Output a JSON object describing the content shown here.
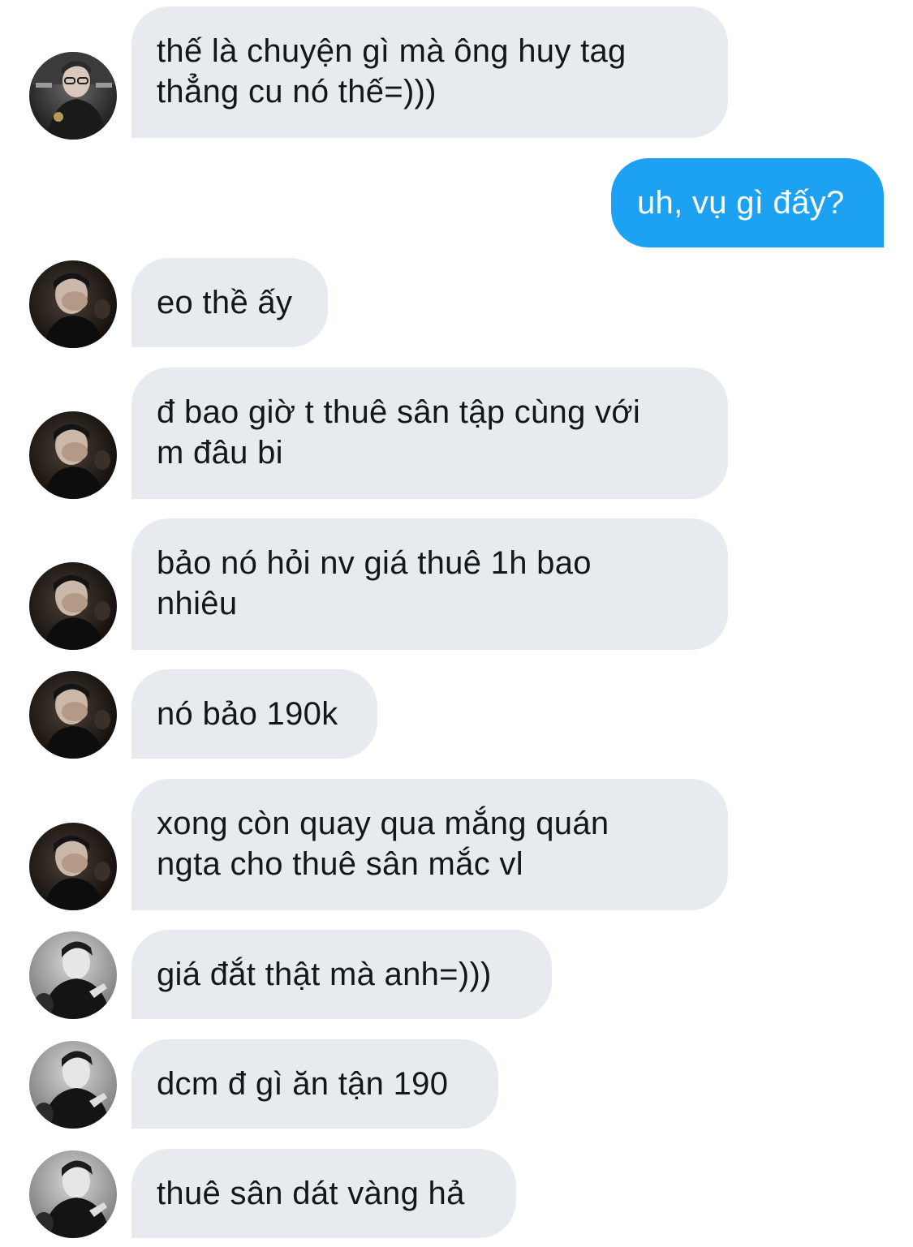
{
  "conversation": {
    "messages": [
      {
        "sender": "user-a",
        "text": "thế là chuyện gì mà ông huy tag\nthẳng cu nó thế=)))"
      },
      {
        "sender": "me",
        "text": "uh, vụ gì đấy?"
      },
      {
        "sender": "user-b",
        "text": "eo thề ấy"
      },
      {
        "sender": "user-b",
        "text": "đ bao giờ t thuê sân tập cùng với\nm đâu bi"
      },
      {
        "sender": "user-b",
        "text": "bảo nó hỏi nv giá thuê 1h bao\nnhiêu"
      },
      {
        "sender": "user-b",
        "text": "nó bảo 190k"
      },
      {
        "sender": "user-b",
        "text": "xong còn quay qua mắng quán\nngta cho thuê sân mắc vl"
      },
      {
        "sender": "user-c",
        "text": "giá đắt thật mà anh=)))"
      },
      {
        "sender": "user-c",
        "text": "dcm đ gì ăn tận 190"
      },
      {
        "sender": "user-c",
        "text": "thuê sân dát vàng hả"
      }
    ]
  },
  "colors": {
    "incoming_bubble": "#e7ebef",
    "outgoing_bubble": "#1da1f2",
    "incoming_text": "#14171a",
    "outgoing_text": "#ffffff"
  },
  "avatar_icons": {
    "user-a": "avatar-photo-icon",
    "user-b": "avatar-photo-icon",
    "user-c": "avatar-photo-icon"
  }
}
